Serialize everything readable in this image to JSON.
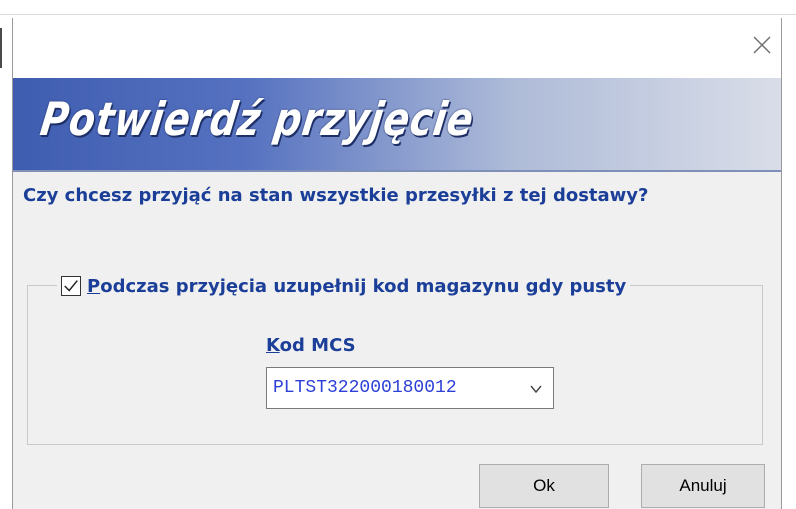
{
  "dialog": {
    "close_icon": "close-icon",
    "banner_title": "Potwierdź przyjęcie",
    "question": "Czy chcesz przyjąć na stan wszystkie przesyłki z tej dostawy?"
  },
  "options": {
    "checkbox_checked": true,
    "checkbox_label_first": "P",
    "checkbox_label_rest": "odczas przyjęcia uzupełnij kod magazynu gdy pusty",
    "kod_label_first": "K",
    "kod_label_rest": "od MCS",
    "kod_value": "PLTST322000180012"
  },
  "buttons": {
    "ok_label": "Ok",
    "cancel_label": "Anuluj"
  },
  "colors": {
    "text_accent": "#1b3f98",
    "banner_start": "#3f5db0",
    "banner_end": "#d9dde8",
    "select_text": "#2c3fd6"
  }
}
